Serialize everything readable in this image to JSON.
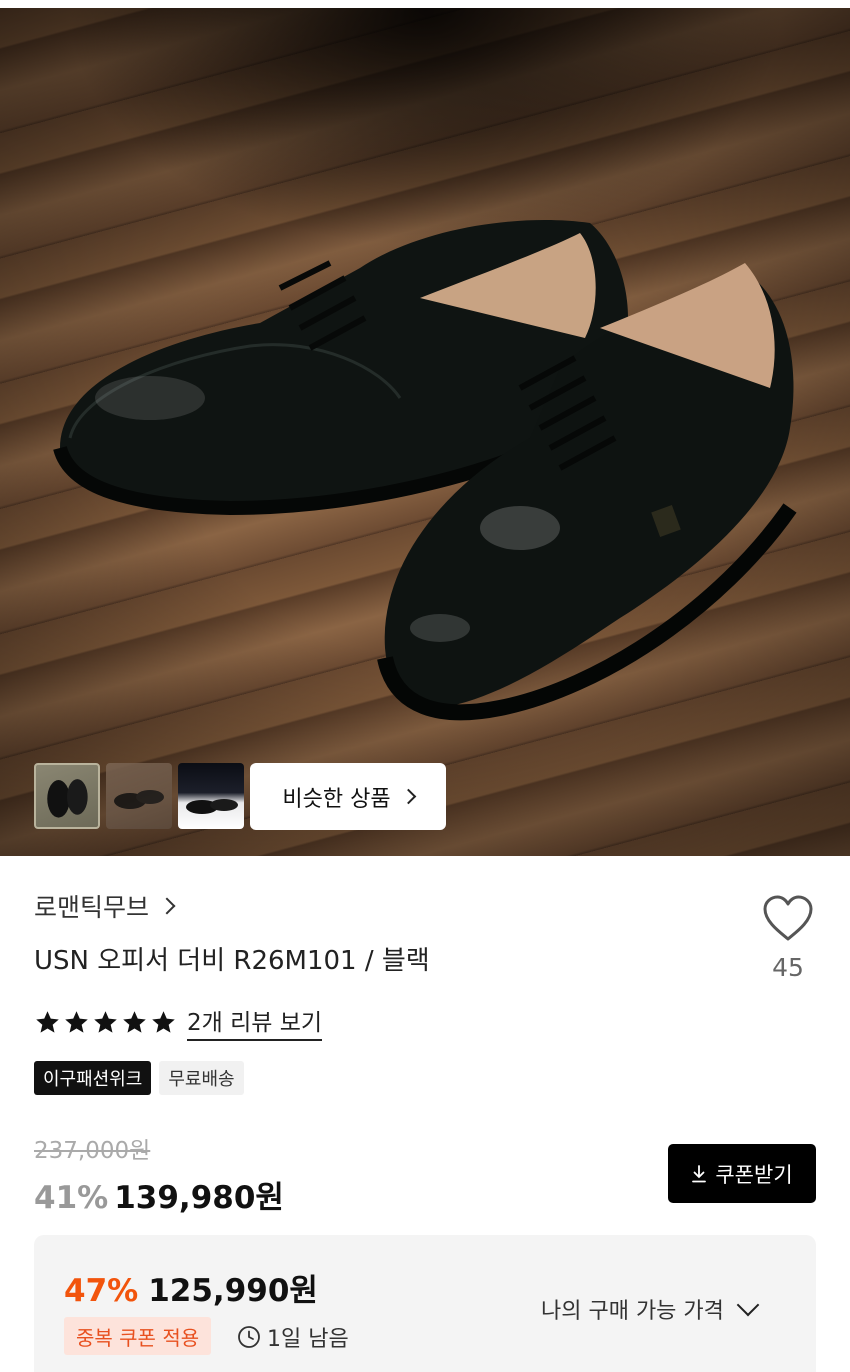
{
  "hero": {
    "similar_button_label": "비슷한 상품",
    "thumbnails": [
      "thumbnail-1",
      "thumbnail-2",
      "thumbnail-3"
    ]
  },
  "product": {
    "brand": "로맨틱무브",
    "title": "USN 오피서 더비 R26M101 / 블랙",
    "like_count": "45",
    "rating_stars": 5,
    "review_link": "2개 리뷰 보기",
    "tags": [
      "이구패션위크",
      "무료배송"
    ],
    "original_price": "237,000원",
    "discount_rate": "41%",
    "sale_price": "139,980원",
    "coupon_button_label": "쿠폰받기"
  },
  "best_price": {
    "discount_rate": "47%",
    "price": "125,990원",
    "coupon_badge": "중복 쿠폰 적용",
    "time_left": "1일 남음",
    "my_price_label": "나의 구매 가능 가격"
  },
  "colors": {
    "accent_orange": "#f2540c",
    "coupon_badge_bg": "#fde3db",
    "dark": "#111111"
  },
  "icons": [
    "chevron-right-icon",
    "heart-icon",
    "star-icon",
    "download-icon",
    "clock-icon",
    "chevron-down-icon"
  ]
}
